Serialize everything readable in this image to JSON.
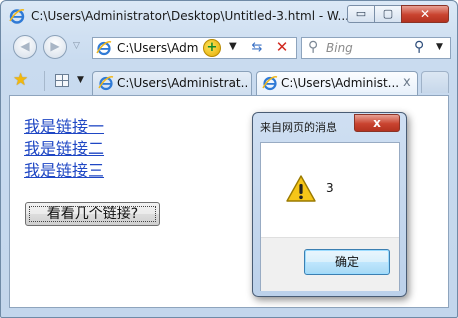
{
  "window": {
    "title": "C:\\Users\\Administrator\\Desktop\\Untitled-3.html - W...",
    "minimize_glyph": "▭",
    "maximize_glyph": "▢",
    "close_glyph": "✕"
  },
  "navbar": {
    "address": "C:\\Users\\Adm",
    "search_placeholder": "Bing"
  },
  "tabs": [
    {
      "label": "C:\\Users\\Administrat...",
      "active": false
    },
    {
      "label": "C:\\Users\\Administ...",
      "active": true,
      "close_glyph": "x"
    }
  ],
  "page": {
    "links": [
      "我是链接一",
      "我是链接二",
      "我是链接三"
    ],
    "button_label": "看看几个链接?"
  },
  "dialog": {
    "title": "来自网页的消息",
    "message": "3",
    "ok_label": "确定",
    "icon": "warning-icon"
  },
  "colors": {
    "link": "#1f47c4",
    "close_red": "#c9432f",
    "frame": "#c9dbef"
  }
}
